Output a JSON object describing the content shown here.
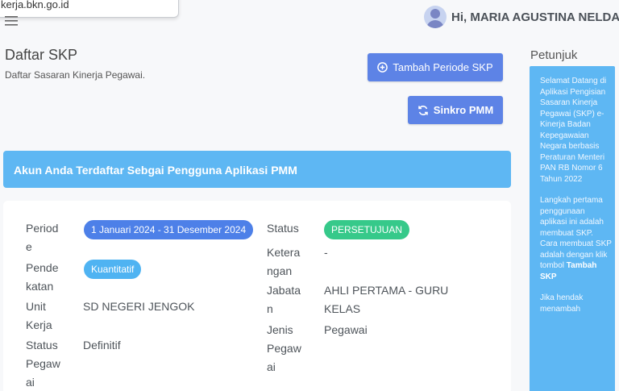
{
  "browser": {
    "url_tooltip": "kerja.bkn.go.id"
  },
  "header": {
    "user_greeting": "Hi, MARIA AGUSTINA NELDA",
    "menu_icon": "hamburger-icon",
    "avatar_icon": "user-avatar-icon"
  },
  "page": {
    "title": "Daftar SKP",
    "subtitle": "Daftar Sasaran Kinerja Pegawai."
  },
  "buttons": {
    "tambah_label": "Tambah Periode SKP",
    "tambah_icon": "plus-circle-icon",
    "sinkro_label": "Sinkro PMM",
    "sinkro_icon": "sync-icon"
  },
  "alert": {
    "text": "Akun Anda Terdaftar Sebgai Pengguna Aplikasi PMM"
  },
  "skp": {
    "periode": {
      "label_1": "Period",
      "label_2": "e",
      "value": "1 Januari 2024 - 31 Desember 2024"
    },
    "pendekatan": {
      "label_1": "Pende",
      "label_2": "katan",
      "value": "Kuantitatif"
    },
    "unit_kerja": {
      "label_1": "Unit",
      "label_2": "Kerja",
      "value": "SD NEGERI JENGOK"
    },
    "status_pegawai": {
      "label_1": "Status",
      "label_2": "Pegaw",
      "label_3": "ai",
      "value": "Definitif"
    },
    "status": {
      "label": "Status",
      "value": "PERSETUJUAN"
    },
    "keterangan": {
      "label_1": "Ketera",
      "label_2": "ngan",
      "value": "-"
    },
    "jabatan": {
      "label_1": "Jabata",
      "label_2": "n",
      "value_1": "AHLI PERTAMA - GURU",
      "value_2": "KELAS"
    },
    "jenis_pegawai": {
      "label_1": "Jenis",
      "label_2": "Pegaw",
      "label_3": "ai",
      "value": "Pegawai"
    }
  },
  "petunjuk": {
    "title": "Petunjuk",
    "para1": "Selamat Datang di Aplikasi Pengisian Sasaran Kinerja Pegawai (SKP) e-Kinerja Badan Kepegawaian Negara berbasis Peraturan Menteri PAN RB Nomor 6 Tahun 2022",
    "para2": "Langkah pertama penggunaan aplikasi ini adalah membuat SKP. Cara membuat SKP adalah dengan klik tombol",
    "para2_bold": "Tambah SKP",
    "para3": "Jika hendak menambah"
  },
  "colors": {
    "primary_button": "#5d83e6",
    "alert_bg": "#5eb7f3",
    "pill_blue": "#4d80e8",
    "pill_green": "#36c98a",
    "pill_light_blue": "#4fb3f2"
  }
}
